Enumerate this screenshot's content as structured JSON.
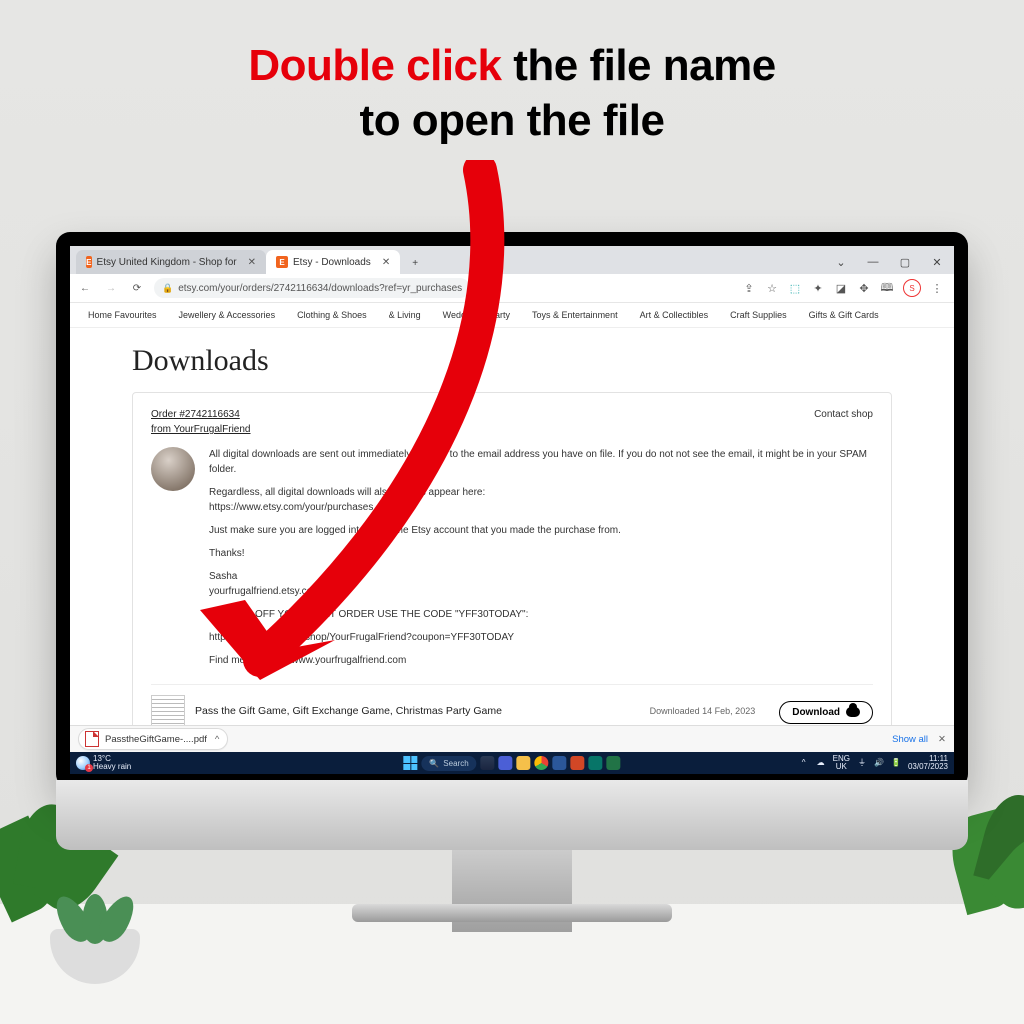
{
  "instruction": {
    "highlight": "Double click",
    "line1_rest": " the file name",
    "line2": "to open the file"
  },
  "browser": {
    "tabs": [
      {
        "title": "Etsy United Kingdom - Shop for",
        "active": false
      },
      {
        "title": "Etsy - Downloads",
        "active": true
      }
    ],
    "url": "etsy.com/your/orders/2742116634/downloads?ref=yr_purchases",
    "window_controls": {
      "minimize": "—",
      "maximize": "▢",
      "close": "✕",
      "collapse": "⌄"
    }
  },
  "etsy_nav": [
    "Home Favourites",
    "Jewellery & Accessories",
    "Clothing & Shoes",
    "& Living",
    "Wedding & Party",
    "Toys & Entertainment",
    "Art & Collectibles",
    "Craft Supplies",
    "Gifts & Gift Cards"
  ],
  "page": {
    "heading": "Downloads",
    "order_link": "Order #2742116634",
    "from_link": "from YourFrugalFriend",
    "contact": "Contact shop",
    "msg": {
      "p1": "All digital downloads are sent out immediately by Etsy to the email address you have on file. If you do not not see the email, it might be in your SPAM folder.",
      "p2": "Regardless, all digital downloads will also always appear here:",
      "p2b": "https://www.etsy.com/your/purchases",
      "p3": "Just make sure you are logged into the same Etsy account that you made the purchase from.",
      "p4": "Thanks!",
      "p5": "Sasha",
      "p6": "yourfrugalfriend.etsy.com",
      "p7": "GET 30% OFF YOUR NEXT ORDER USE THE CODE \"YFF30TODAY\":",
      "p8": "https://www.etsy.com/shop/YourFrugalFriend?coupon=YFF30TODAY",
      "p9": "Find me online at: www.yourfrugalfriend.com"
    },
    "file": {
      "title": "Pass the Gift Game, Gift Exchange Game, Christmas Party Game",
      "date": "Downloaded 14 Feb, 2023",
      "button": "Download"
    }
  },
  "download_bar": {
    "chip": "PasstheGiftGame-....pdf",
    "show_all": "Show all"
  },
  "taskbar": {
    "weather_temp": "13°C",
    "weather_desc": "Heavy rain",
    "search": "Search",
    "lang1": "ENG",
    "lang2": "UK",
    "time": "11:11",
    "date": "03/07/2023"
  }
}
